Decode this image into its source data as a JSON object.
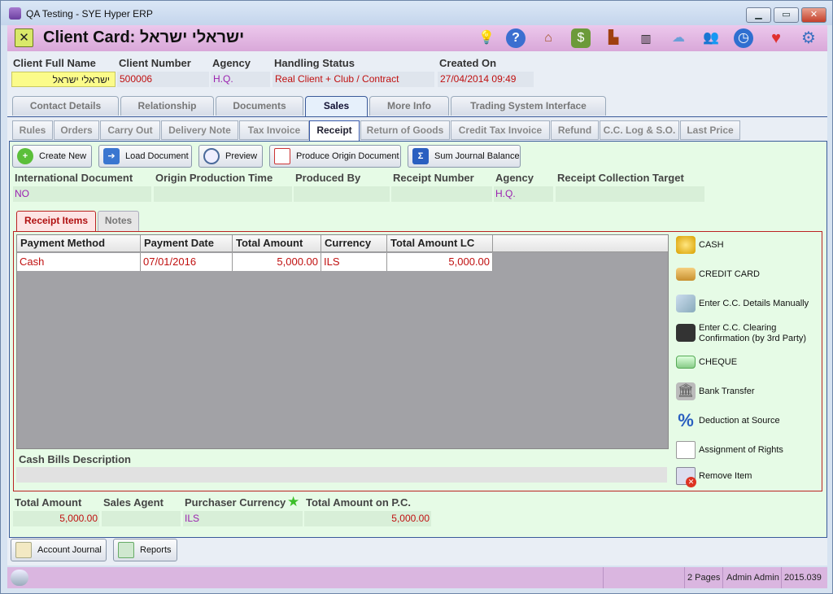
{
  "window": {
    "title": "QA Testing - SYE Hyper ERP",
    "minimize": "▁",
    "maximize": "▭",
    "close": "✕"
  },
  "header": {
    "title": "Client Card: ישראלי ישראל",
    "close_label": "✕",
    "icons": [
      "lightbulb-icon",
      "help-icon",
      "home-icon",
      "money-icon",
      "factory-icon",
      "barcode-icon",
      "cloud-icon",
      "users-icon",
      "clock-icon",
      "heart-icon",
      "gear-icon"
    ]
  },
  "client": {
    "full_name_label": "Client Full Name",
    "full_name": "ישראלי ישראל",
    "number_label": "Client Number",
    "number": "500006",
    "agency_label": "Agency",
    "agency": "H.Q.",
    "status_label": "Handling Status",
    "status": "Real Client + Club / Contract",
    "created_label": "Created On",
    "created": "27/04/2014 09:49"
  },
  "main_tabs": [
    "Contact Details",
    "Relationship",
    "Documents",
    "Sales",
    "More Info",
    "Trading System Interface"
  ],
  "sub_tabs": [
    "Rules",
    "Orders",
    "Carry Out",
    "Delivery Note",
    "Tax Invoice",
    "Receipt",
    "Return of Goods",
    "Credit Tax Invoice",
    "Refund",
    "C.C. Log & S.O.",
    "Last Price"
  ],
  "toolbar": {
    "create_new": "Create New",
    "load_document": "Load Document",
    "preview": "Preview",
    "produce_origin": "Produce Origin Document",
    "sum_journal": "Sum Journal Balance"
  },
  "receipt": {
    "intl_doc_label": "International Document",
    "intl_doc": "NO",
    "origin_time_label": "Origin Production Time",
    "origin_time": "",
    "produced_by_label": "Produced By",
    "produced_by": "",
    "receipt_number_label": "Receipt Number",
    "receipt_number": "",
    "agency_label": "Agency",
    "agency": "H.Q.",
    "collection_label": "Receipt Collection Target",
    "collection": ""
  },
  "inner_tabs": [
    "Receipt Items",
    "Notes"
  ],
  "grid": {
    "columns": [
      "Payment Method",
      "Payment Date",
      "Total Amount",
      "Currency",
      "Total Amount LC"
    ],
    "rows": [
      [
        "Cash",
        "07/01/2016",
        "5,000.00",
        "ILS",
        "5,000.00"
      ]
    ]
  },
  "cash_bills_label": "Cash Bills Description",
  "actions": [
    "CASH",
    "CREDIT CARD",
    "Enter C.C. Details Manually",
    "Enter C.C. Clearing Confirmation (by 3rd Party)",
    "CHEQUE",
    "Bank Transfer",
    "Deduction at Source",
    "Assignment of Rights",
    "Remove Item"
  ],
  "totals": {
    "total_amount_label": "Total Amount",
    "total_amount": "5,000.00",
    "sales_agent_label": "Sales Agent",
    "sales_agent": "",
    "purchaser_currency_label": "Purchaser Currency",
    "purchaser_currency": "ILS",
    "total_pc_label": "Total Amount on P.C.",
    "total_pc": "5,000.00"
  },
  "bottom": {
    "account_journal": "Account Journal",
    "reports": "Reports"
  },
  "statusbar": {
    "pages": "2 Pages",
    "user": "Admin Admin",
    "version": "2015.039"
  }
}
